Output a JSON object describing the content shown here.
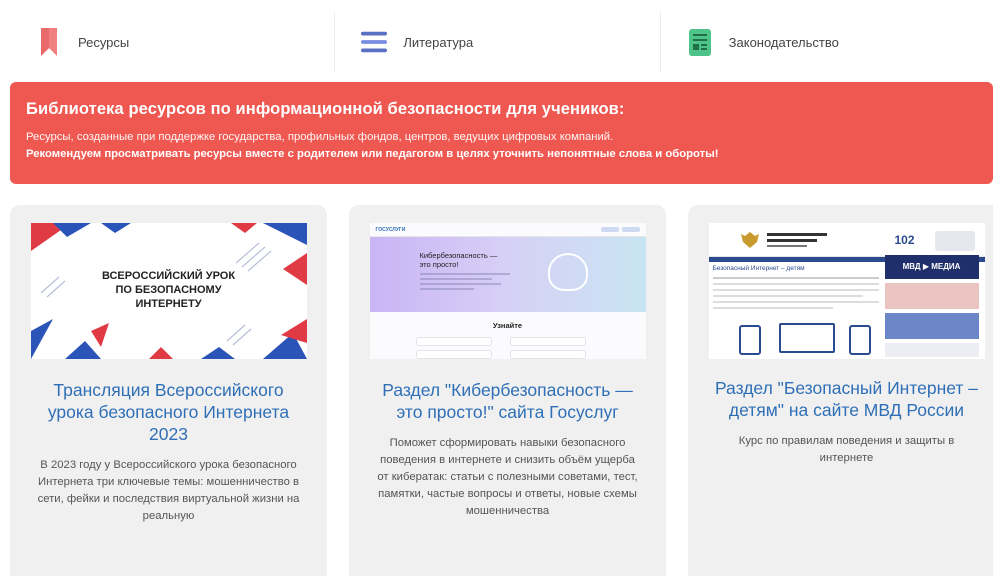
{
  "nav": {
    "items": [
      {
        "label": "Ресурсы",
        "icon": "bookmark-icon"
      },
      {
        "label": "Литература",
        "icon": "list-lines-icon"
      },
      {
        "label": "Законодательство",
        "icon": "document-icon"
      }
    ]
  },
  "banner": {
    "title": "Библиотека ресурсов по информационной безопасности для учеников:",
    "subtitle": "Ресурсы, созданные при поддержке государства, профильных фондов, центров, ведущих цифровых компаний.",
    "note": "Рекомендуем просматривать ресурсы вместе с родителем или педагогом в целях уточнить непонятные слова и обороты!"
  },
  "cards": [
    {
      "thumb_text": [
        "ВСЕРОССИЙСКИЙ УРОК",
        "ПО БЕЗОПАСНОМУ",
        "ИНТЕРНЕТУ"
      ],
      "title": "Трансляция Всероссийского урока безопасного Интернета 2023",
      "desc": "В 2023 году у Всероссийского урока безопасного Интернета три ключевые темы: мошенничество в сети, фейки и последствия виртуальной жизни на реальную"
    },
    {
      "thumb_brand": "ГОСУСЛУГИ",
      "thumb_heading": [
        "Кибербезопасность —",
        "это просто!"
      ],
      "thumb_know": "Узнайте",
      "title": "Раздел \"Кибербезопасность — это просто!\" сайта Госуслуг",
      "desc": "Поможет сформировать навыки безопасного поведения в интернете и снизить объём ущерба от кибератак: статьи с полезными советами, тест, памятки, частые вопросы и ответы, новые схемы мошенничества"
    },
    {
      "thumb_number": "102",
      "thumb_media": "МВД ▶ МЕДИА",
      "thumb_heading": "Безопасный Интернет – детям",
      "title": "Раздел \"Безопасный Интернет – детям\" на сайте МВД России",
      "desc": "Курс по правилам поведения и защиты в интернете"
    }
  ],
  "colors": {
    "banner": "#ef5751",
    "card_title": "#2f6fb6",
    "card_bg": "#f0f0f1"
  }
}
